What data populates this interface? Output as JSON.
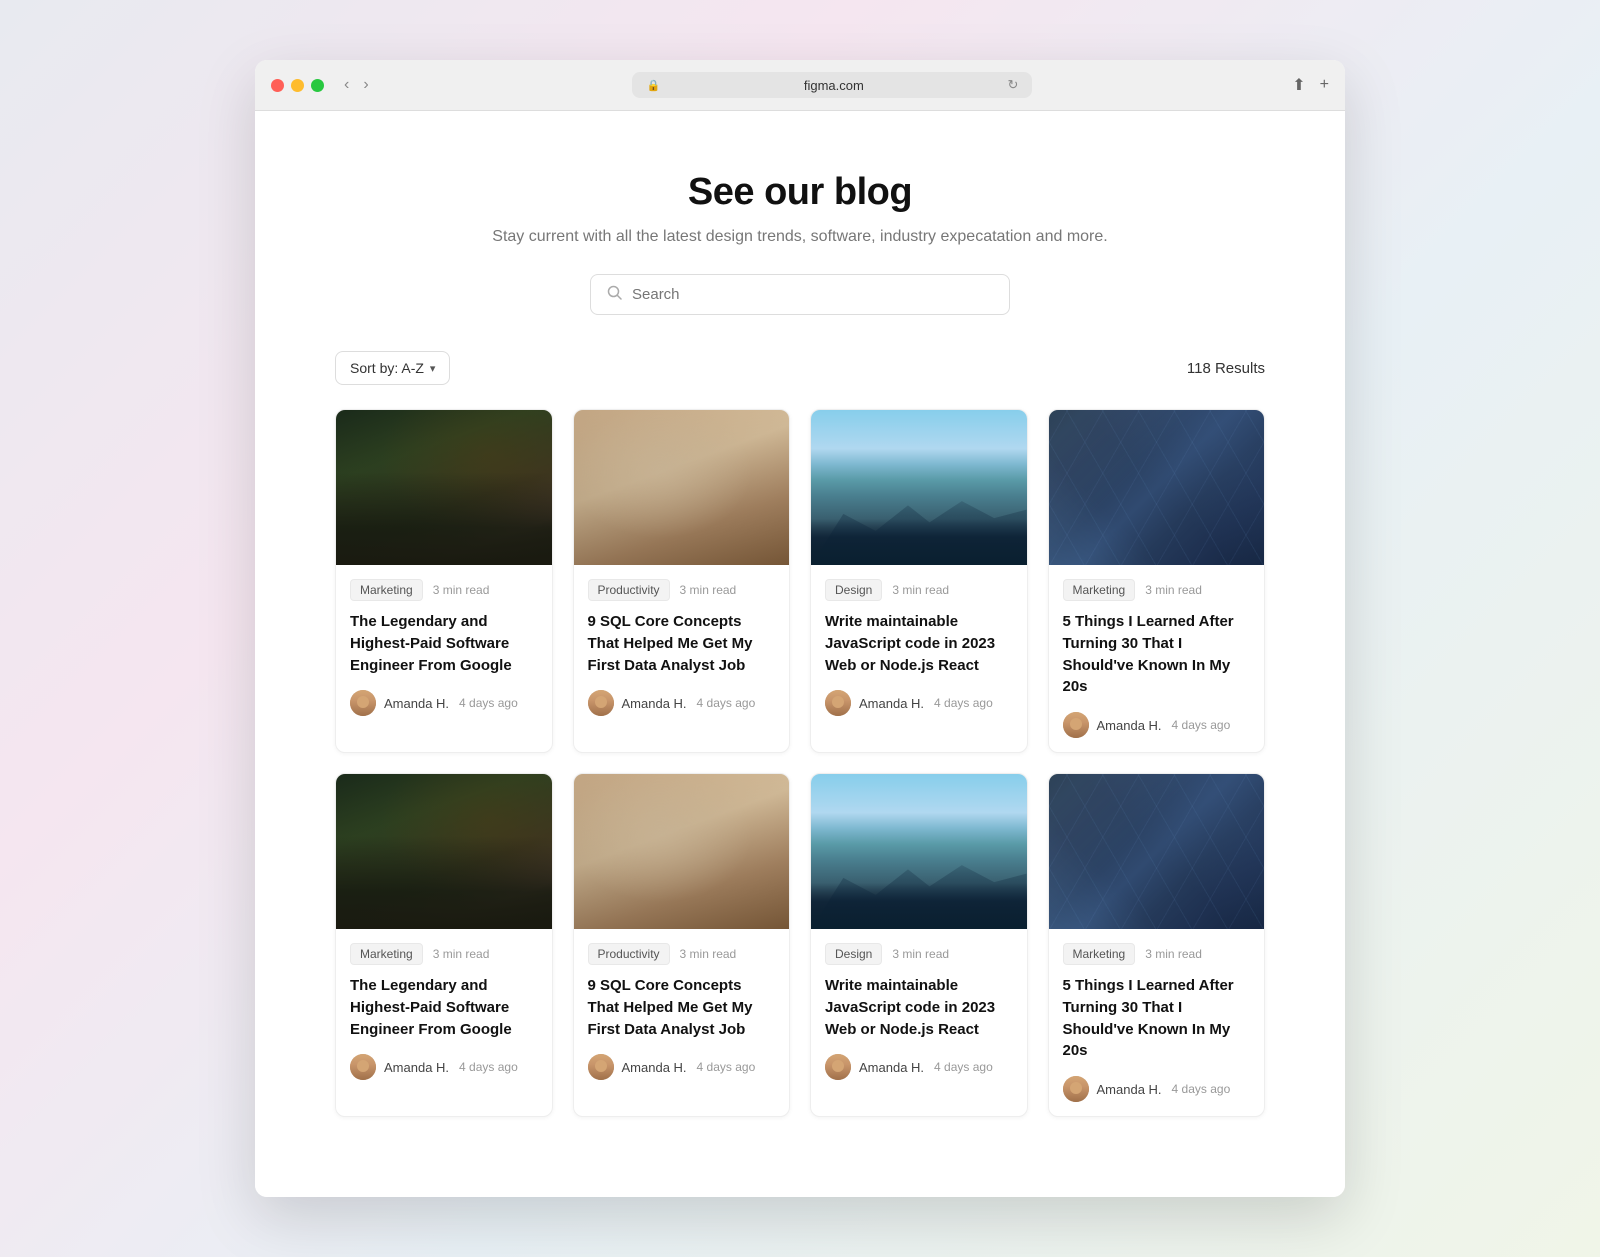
{
  "browser": {
    "url": "figma.com",
    "back_label": "‹",
    "forward_label": "›",
    "refresh_label": "↻",
    "share_label": "⬆",
    "new_tab_label": "+"
  },
  "hero": {
    "title": "See our blog",
    "subtitle": "Stay current with all the latest design trends, software, industry expecatation and more.",
    "search_placeholder": "Search"
  },
  "toolbar": {
    "sort_label": "Sort by: A-Z",
    "results_text": "118 Results"
  },
  "articles": [
    {
      "tag": "Marketing",
      "read_time": "3 min read",
      "title": "The Legendary and Highest-Paid Software Engineer From Google",
      "author": "Amanda H.",
      "time": "4 days ago",
      "image_type": "city"
    },
    {
      "tag": "Productivity",
      "read_time": "3 min read",
      "title": "9 SQL Core Concepts That Helped Me Get My First Data Analyst Job",
      "author": "Amanda H.",
      "time": "4 days ago",
      "image_type": "people"
    },
    {
      "tag": "Design",
      "read_time": "3 min read",
      "title": "Write maintainable JavaScript code in 2023 Web or Node.js React",
      "author": "Amanda H.",
      "time": "4 days ago",
      "image_type": "mountain"
    },
    {
      "tag": "Marketing",
      "read_time": "3 min read",
      "title": "5 Things I Learned After Turning 30 That I Should've Known In My 20s",
      "author": "Amanda H.",
      "time": "4 days ago",
      "image_type": "geometric"
    },
    {
      "tag": "Marketing",
      "read_time": "3 min read",
      "title": "The Legendary and Highest-Paid Software Engineer From Google",
      "author": "Amanda H.",
      "time": "4 days ago",
      "image_type": "city"
    },
    {
      "tag": "Productivity",
      "read_time": "3 min read",
      "title": "9 SQL Core Concepts That Helped Me Get My First Data Analyst Job",
      "author": "Amanda H.",
      "time": "4 days ago",
      "image_type": "people"
    },
    {
      "tag": "Design",
      "read_time": "3 min read",
      "title": "Write maintainable JavaScript code in 2023 Web or Node.js React",
      "author": "Amanda H.",
      "time": "4 days ago",
      "image_type": "mountain"
    },
    {
      "tag": "Marketing",
      "read_time": "3 min read",
      "title": "5 Things I Learned After Turning 30 That I Should've Known In My 20s",
      "author": "Amanda H.",
      "time": "4 days ago",
      "image_type": "geometric"
    }
  ]
}
